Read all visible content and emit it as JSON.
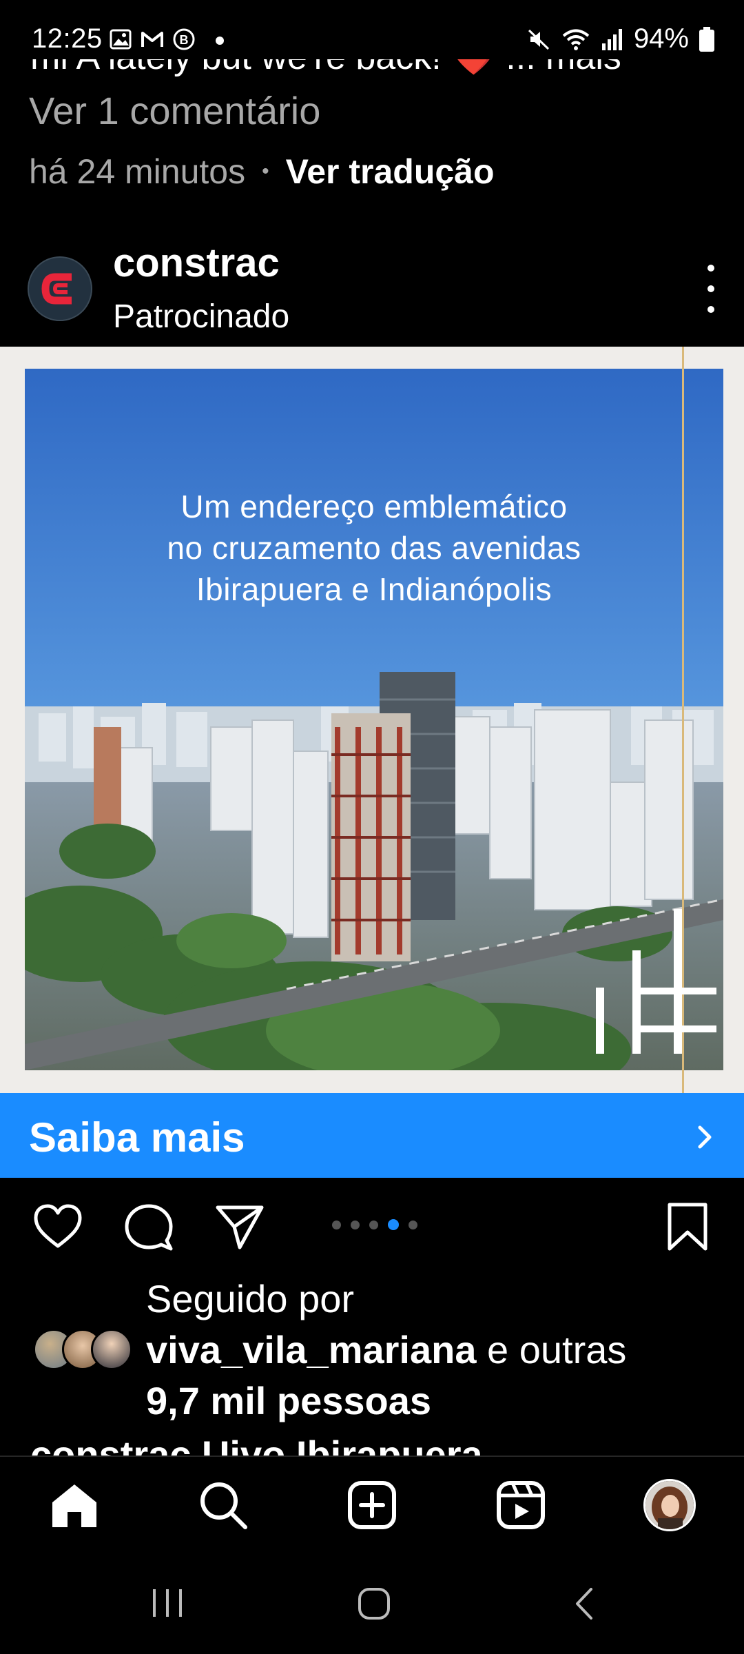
{
  "status_bar": {
    "time": "12:25",
    "battery_percent": "94%",
    "icons": [
      "gallery-icon",
      "gmail-icon",
      "b-icon",
      "dot-icon",
      "mute-icon",
      "wifi-icon",
      "signal-icon",
      "battery-icon"
    ]
  },
  "previous_post": {
    "caption_fragment": "mi A lately but we're back! ❤️ ... mais",
    "view_comments": "Ver 1 comentário",
    "timestamp": "há 24 minutos",
    "separator": "•",
    "translate": "Ver tradução"
  },
  "post": {
    "username": "constrac",
    "sponsored_label": "Patrocinado",
    "headline_lines": [
      "Um endereço emblemático",
      "no cruzamento das avenidas",
      "Ibirapuera e Indianópolis"
    ],
    "cta_label": "Saiba mais",
    "carousel": {
      "count": 5,
      "active_index": 3
    },
    "followed_by_prefix": "Seguido por",
    "followed_by_user": "viva_vila_mariana",
    "followed_by_suffix": " e outras",
    "followed_by_count": "9,7 mil pessoas",
    "caption_fragment": "constrac Uivo Ibirapuera"
  },
  "colors": {
    "background": "#000000",
    "accent_blue": "#1a8cff",
    "secondary_text": "#a8a8a8",
    "brand_red": "#e8253a",
    "gold": "#d9b97a"
  },
  "bottom_nav": {
    "items": [
      "home-icon",
      "search-icon",
      "create-icon",
      "reels-icon",
      "profile-avatar"
    ]
  },
  "system_nav": {
    "items": [
      "recents-icon",
      "home-circle-icon",
      "back-icon"
    ]
  }
}
